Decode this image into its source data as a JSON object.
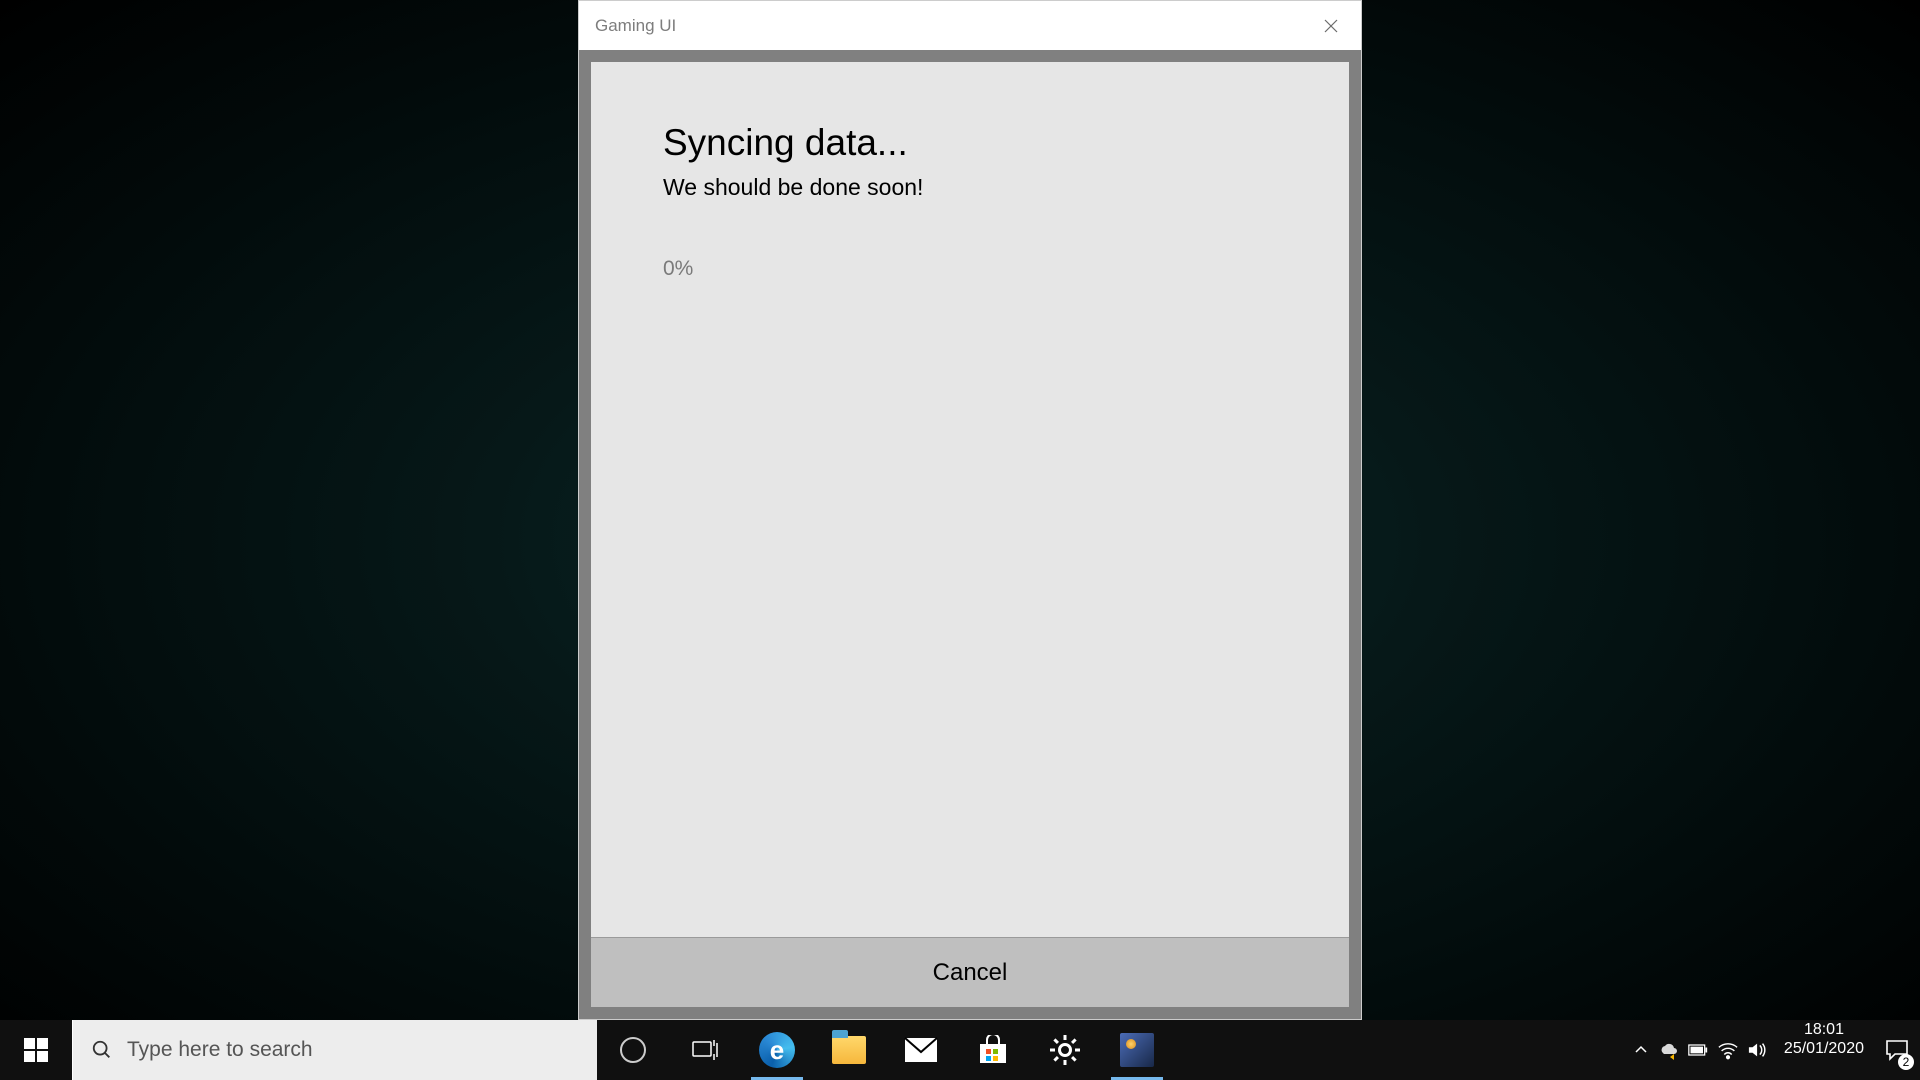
{
  "dialog": {
    "window_title": "Gaming UI",
    "heading": "Syncing data...",
    "subtext": "We should be done soon!",
    "progress_text": "0%",
    "cancel_label": "Cancel"
  },
  "taskbar": {
    "search_placeholder": "Type here to search",
    "tray": {
      "time": "18:01",
      "date": "25/01/2020",
      "notification_count": "2"
    }
  }
}
